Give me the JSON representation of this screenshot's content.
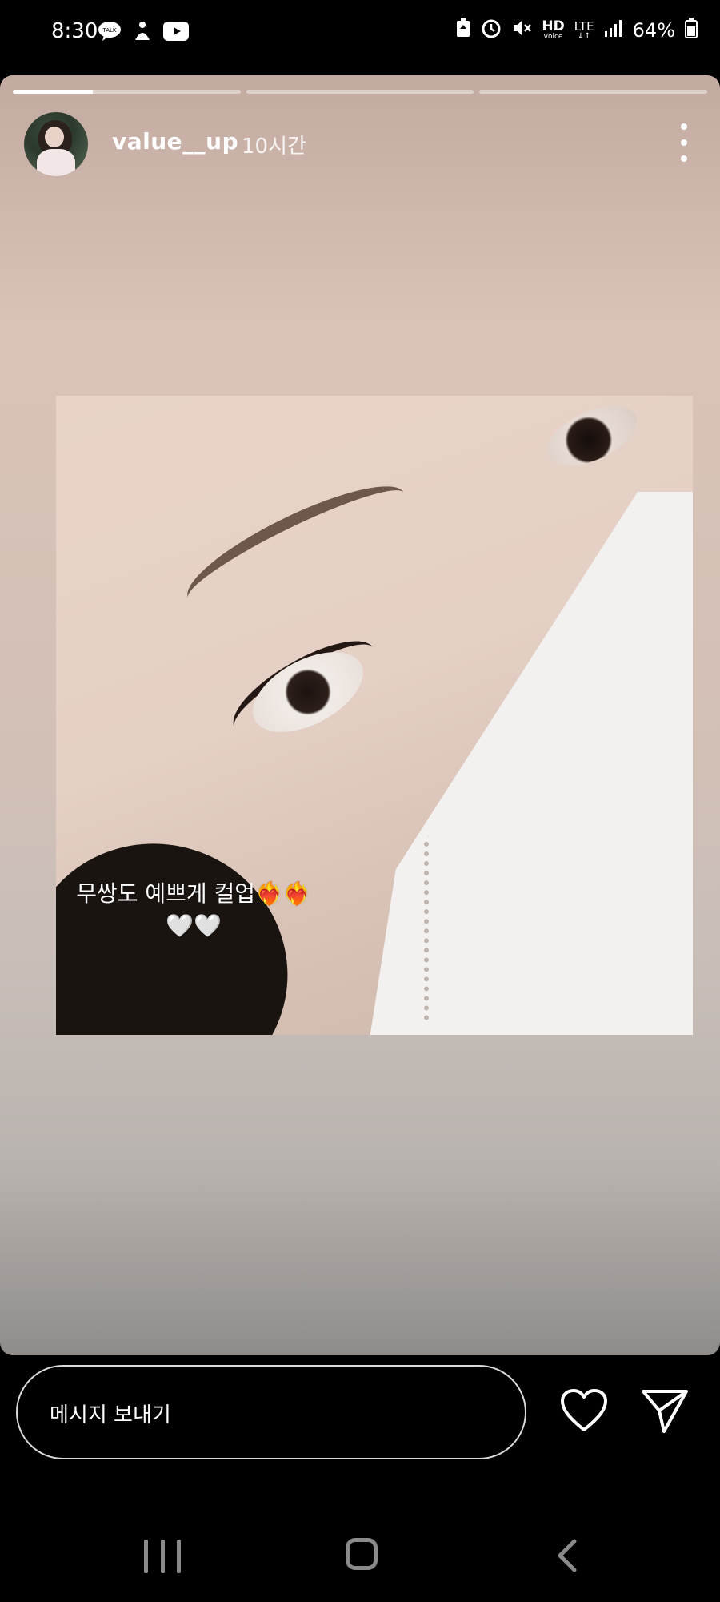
{
  "status_bar": {
    "time": "8:30",
    "left_icons": [
      "talk-icon",
      "accessibility-icon",
      "youtube-icon"
    ],
    "right_icons": [
      "battery-saver-icon",
      "alarm-icon",
      "mute-icon",
      "hd-voice-icon",
      "lte-icon",
      "signal-icon"
    ],
    "hd_label": "HD",
    "voice_label": "voice",
    "lte_label": "LTE",
    "battery": "64%"
  },
  "story": {
    "progress_segments": [
      0.35,
      0,
      0
    ],
    "username": "value__up",
    "time_ago": "10시간",
    "caption_line1": "무쌍도 예쁘게 컬업❤️‍🔥❤️‍🔥",
    "caption_line2": "🤍🤍"
  },
  "reply_bar": {
    "placeholder": "메시지 보내기",
    "like_icon": "heart-icon",
    "send_icon": "paper-plane-icon"
  },
  "nav_bar": {
    "items": [
      "recent-apps-icon",
      "home-icon",
      "back-icon"
    ]
  },
  "colors": {
    "background": "#000000",
    "story_top": "#c2aaa0",
    "story_bottom": "#8f8c8a"
  }
}
